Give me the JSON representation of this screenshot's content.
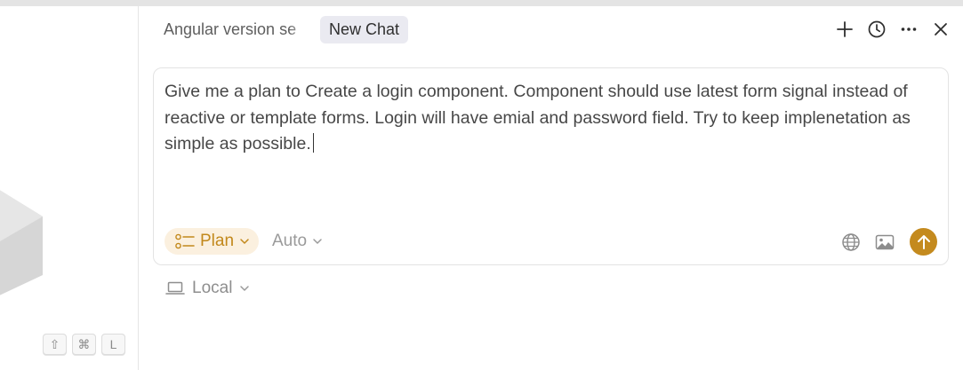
{
  "tabs": [
    {
      "label": "Angular version se",
      "active": false
    },
    {
      "label": "New Chat",
      "active": true
    }
  ],
  "toolbar": {
    "icons": [
      "plus-icon",
      "history-icon",
      "more-icon",
      "close-icon"
    ]
  },
  "composer": {
    "text": "Give me a plan to Create a login component.  Component should use latest form signal instead of reactive or template forms. Login will have emial and password field. Try to keep implenetation as simple as possible.",
    "mode_label": "Plan",
    "model_label": "Auto",
    "icons": [
      "globe-icon",
      "image-icon",
      "send-arrow-icon"
    ]
  },
  "environment": {
    "label": "Local"
  },
  "shortcut_keys": [
    "⇧",
    "⌘",
    "L"
  ],
  "colors": {
    "accent": "#c48a1e",
    "plan_bg": "#fbf0df",
    "tab_active_bg": "#eaeaf1"
  }
}
